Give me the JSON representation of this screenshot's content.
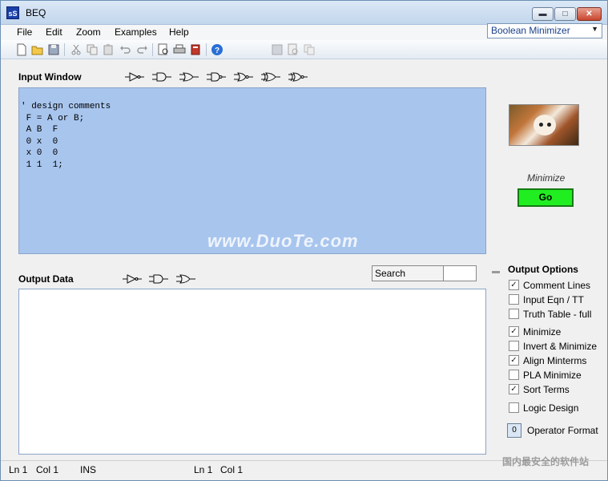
{
  "window": {
    "title": "BEQ",
    "app_icon_text": "sS"
  },
  "menu": {
    "items": [
      "File",
      "Edit",
      "Zoom",
      "Examples",
      "Help"
    ]
  },
  "mode_select": {
    "value": "Boolean Minimizer"
  },
  "toolbar": {
    "icons": [
      "new-icon",
      "open-icon",
      "save-icon",
      "cut-icon",
      "copy-icon",
      "paste-icon",
      "undo-icon",
      "redo-icon",
      "print-preview-icon",
      "print-icon",
      "book-icon",
      "help-icon",
      "save-disabled-icon",
      "preview-disabled-icon",
      "copy-disabled-icon"
    ]
  },
  "input_window": {
    "label": "Input Window",
    "gate_icons": [
      "not-gate-icon",
      "and-gate-icon",
      "or-gate-icon",
      "nand-gate-icon",
      "nor-gate-icon",
      "xor-gate-icon",
      "xnor-gate-icon"
    ],
    "lines": [
      "' design comments",
      "",
      " F = A or B;",
      "",
      " A B  F",
      " 0 x  0",
      " x 0  0",
      " 1 1  1;"
    ],
    "watermark": "www.DuoTe.com"
  },
  "right_panel": {
    "minimize_label": "Minimize",
    "go_label": "Go"
  },
  "output": {
    "label": "Output Data",
    "gate_icons": [
      "not-gate-icon",
      "and-gate-icon",
      "or-gate-icon"
    ],
    "search_label": "Search"
  },
  "output_options": {
    "title": "Output Options",
    "options": [
      {
        "label": "Comment Lines",
        "checked": true
      },
      {
        "label": "Input Eqn / TT",
        "checked": false
      },
      {
        "label": "Truth Table - full",
        "checked": false
      },
      {
        "label": "Minimize",
        "checked": true
      },
      {
        "label": "Invert & Minimize",
        "checked": false
      },
      {
        "label": "Align Minterms",
        "checked": true
      },
      {
        "label": "PLA Minimize",
        "checked": false
      },
      {
        "label": "Sort Terms",
        "checked": true
      },
      {
        "label": "Logic Design",
        "checked": false
      }
    ],
    "operator_format_label": "Operator Format",
    "operator_format_icon_text": "0"
  },
  "status": {
    "left": [
      "Ln 1",
      "Col 1",
      "INS"
    ],
    "right": [
      "Ln 1",
      "Col 1"
    ]
  },
  "corner_watermark": "国内最安全的软件站"
}
